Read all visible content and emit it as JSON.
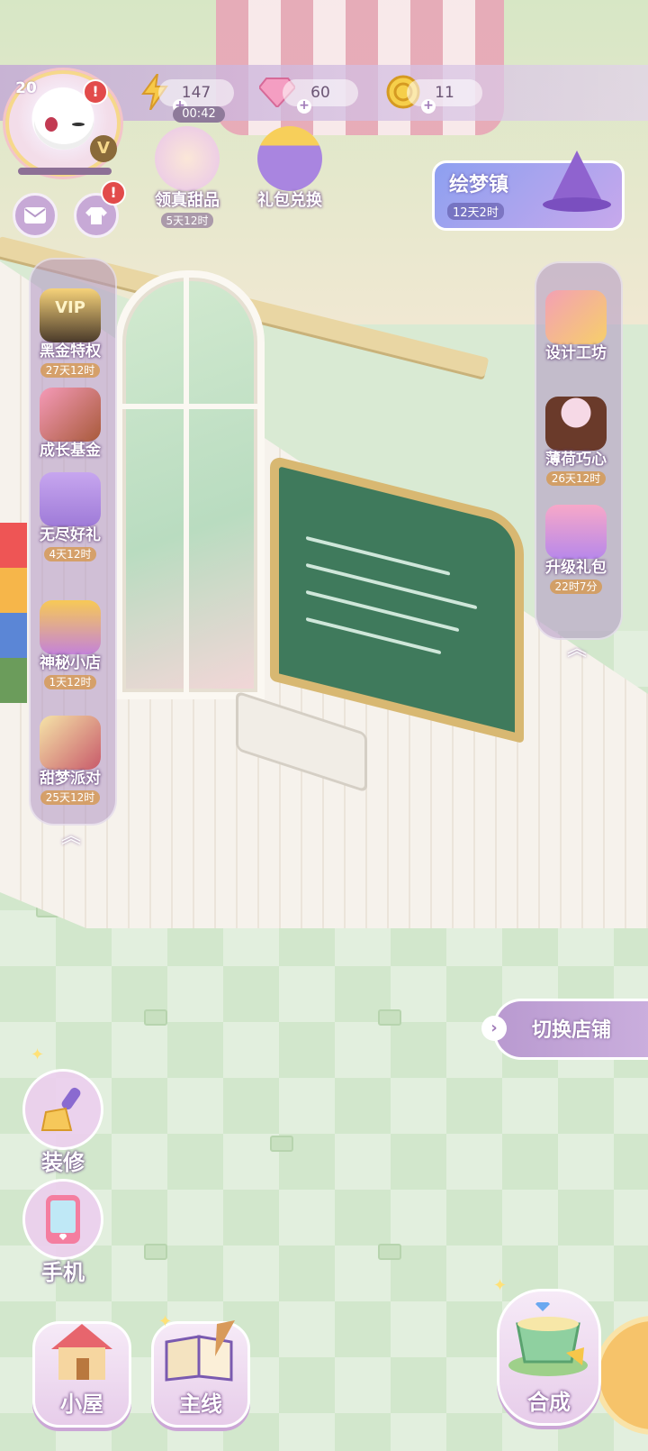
{
  "player": {
    "level": "20",
    "avatar": "white-cat-avatar"
  },
  "resources": {
    "energy": {
      "value": "147",
      "timer": "00:42",
      "icon": "lightning-icon"
    },
    "gems": {
      "value": "60",
      "icon": "diamond-icon"
    },
    "coins": {
      "value": "11",
      "icon": "coin-icon"
    }
  },
  "alerts": {
    "avatar": "!",
    "outfit": "!"
  },
  "top_events": [
    {
      "label": "领真甜品",
      "time": "5天12时",
      "icon": "dessert-icon"
    },
    {
      "label": "礼包兑换",
      "icon": "gift-box-icon"
    }
  ],
  "town_banner": {
    "title": "绘梦镇",
    "time": "12天2时"
  },
  "left_panel": [
    {
      "label": "黑金特权",
      "time": "27天12时",
      "icon": "vip-card-icon",
      "badge": "VIP"
    },
    {
      "label": "成长基金",
      "time": "",
      "icon": "gift-cake-icon"
    },
    {
      "label": "无尽好礼",
      "time": "4天12时",
      "icon": "cat-gift-icon"
    },
    {
      "label": "神秘小店",
      "time": "1天12时",
      "icon": "mystery-box-icon"
    },
    {
      "label": "甜梦派对",
      "time": "25天12时",
      "icon": "party-cards-icon"
    }
  ],
  "right_panel": [
    {
      "label": "设计工坊",
      "time": "",
      "icon": "ruler-pencil-icon"
    },
    {
      "label": "薄荷巧心",
      "time": "26天12时",
      "icon": "chocolate-cake-icon"
    },
    {
      "label": "升级礼包",
      "time": "22时7分",
      "icon": "upgrade-gift-icon"
    }
  ],
  "switch_shop": {
    "label": "切换店铺"
  },
  "tools": [
    {
      "label": "装修",
      "icon": "brush-icon"
    },
    {
      "label": "手机",
      "icon": "phone-icon"
    }
  ],
  "bottom_nav": [
    {
      "label": "小屋",
      "icon": "house-icon"
    },
    {
      "label": "主线",
      "icon": "book-quill-icon"
    },
    {
      "label": "合成",
      "icon": "teacup-icon"
    }
  ],
  "colors": {
    "panel": "#b096c4",
    "accent_gold": "#f6d88b",
    "alert": "#e24b4b",
    "floor": "#d2e7cc"
  }
}
